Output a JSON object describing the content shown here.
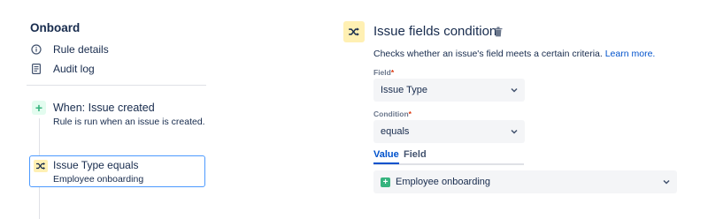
{
  "left": {
    "rule_name": "Onboard",
    "nav": [
      {
        "label": "Rule details",
        "icon": "info-icon"
      },
      {
        "label": "Audit log",
        "icon": "document-icon"
      }
    ],
    "trigger": {
      "icon": "plus-icon",
      "title": "When: Issue created",
      "subtitle": "Rule is run when an issue is created."
    },
    "condition": {
      "icon": "shuffle-icon",
      "title": "Issue Type equals",
      "subtitle": "Employee onboarding"
    }
  },
  "panel": {
    "icon": "shuffle-icon",
    "title": "Issue fields condition",
    "description": "Checks whether an issue's field meets a certain criteria.",
    "learn_more": "Learn more.",
    "field_label": "Field",
    "field_value": "Issue Type",
    "condition_label": "Condition",
    "condition_value": "equals",
    "required_marker": "*",
    "tabs": [
      {
        "label": "Value",
        "active": true
      },
      {
        "label": "Field",
        "active": false
      }
    ],
    "value_selected": "Employee onboarding"
  },
  "colors": {
    "accent": "#0052CC",
    "focus_border": "#4C9AFF",
    "condition_bg": "#FFF0B3",
    "trigger_green": "#36B37E",
    "required": "#DE350B",
    "select_bg": "#F4F5F7"
  }
}
